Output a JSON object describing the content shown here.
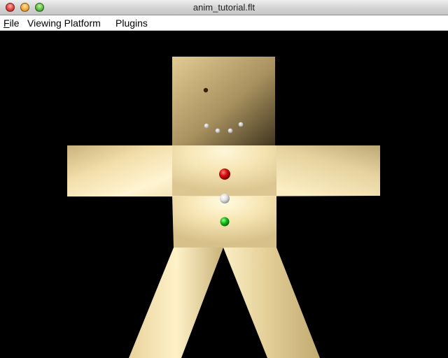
{
  "window": {
    "title": "anim_tutorial.flt"
  },
  "menubar": {
    "items": [
      {
        "label": "File",
        "mnemonic": "F",
        "rest": "ile"
      },
      {
        "label": "Viewing Platform"
      },
      {
        "label": "Plugins"
      }
    ]
  },
  "viewport": {
    "background": "#000000",
    "model": {
      "skin_light": "#fdf0c4",
      "skin_mid": "#e8d49a",
      "skin_dark": "#a08a5a",
      "head_top": "#d8c088",
      "head_bottom": "#4a3e24"
    },
    "buttons": [
      {
        "name": "red",
        "color": "#d40f0f"
      },
      {
        "name": "white",
        "color": "#e8e8e8"
      },
      {
        "name": "green",
        "color": "#18c018"
      }
    ]
  }
}
